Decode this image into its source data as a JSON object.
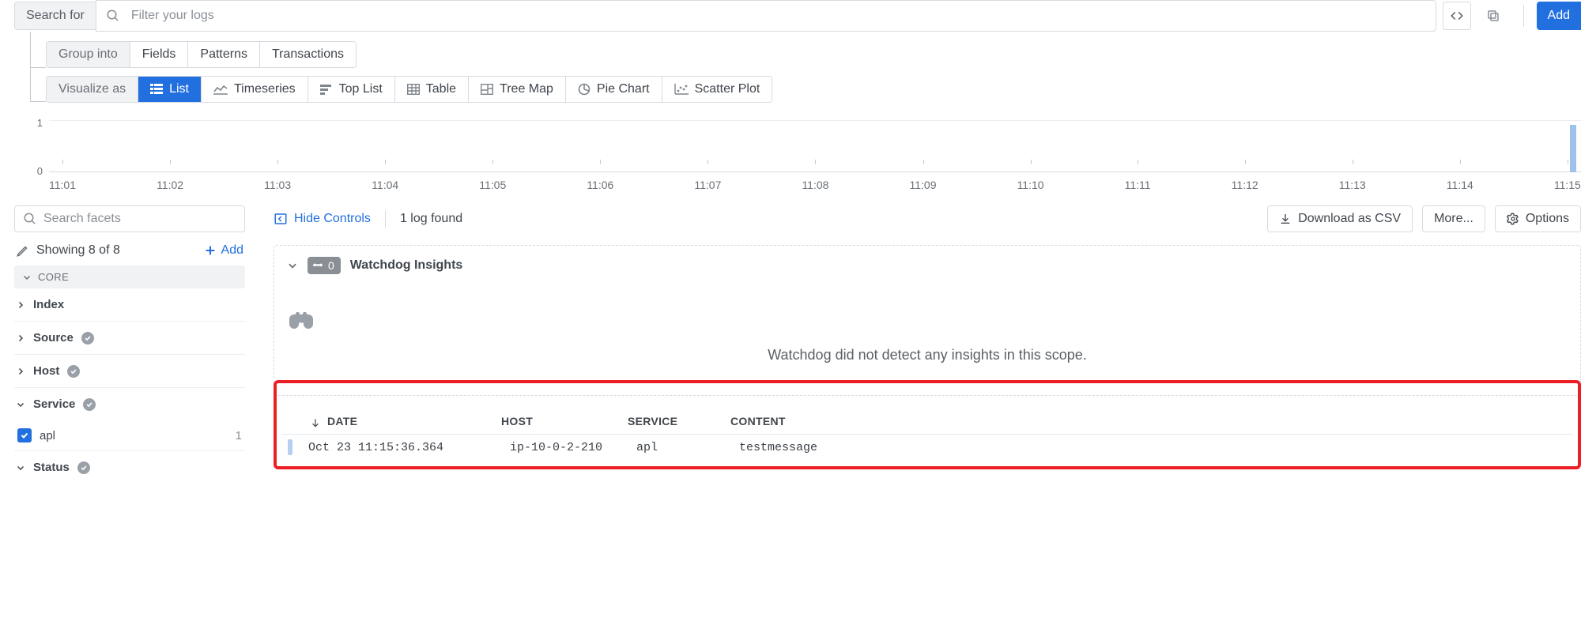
{
  "search": {
    "label": "Search for",
    "placeholder": "Filter your logs"
  },
  "add_label": "Add",
  "group_into": {
    "label": "Group into",
    "options": [
      "Fields",
      "Patterns",
      "Transactions"
    ]
  },
  "visualize": {
    "label": "Visualize as",
    "active": "List",
    "options": [
      "List",
      "Timeseries",
      "Top List",
      "Table",
      "Tree Map",
      "Pie Chart",
      "Scatter Plot"
    ]
  },
  "chart_data": {
    "type": "bar",
    "title": "",
    "xlabel": "",
    "ylabel": "",
    "ylim": [
      0,
      1
    ],
    "yticks": [
      0,
      1
    ],
    "categories": [
      "11:01",
      "11:02",
      "11:03",
      "11:04",
      "11:05",
      "11:06",
      "11:07",
      "11:08",
      "11:09",
      "11:10",
      "11:11",
      "11:12",
      "11:13",
      "11:14",
      "11:15"
    ],
    "values": [
      0,
      0,
      0,
      0,
      0,
      0,
      0,
      0,
      0,
      0,
      0,
      0,
      0,
      0,
      1
    ]
  },
  "facets": {
    "search_placeholder": "Search facets",
    "showing_prefix": "Showing",
    "showing_count": "8 of 8",
    "add_label": "Add",
    "group_label": "CORE",
    "items": [
      {
        "label": "Index",
        "expanded": false,
        "has_dot": false
      },
      {
        "label": "Source",
        "expanded": false,
        "has_dot": true
      },
      {
        "label": "Host",
        "expanded": false,
        "has_dot": true
      },
      {
        "label": "Service",
        "expanded": true,
        "has_dot": true
      },
      {
        "label": "Status",
        "expanded": true,
        "has_dot": true
      }
    ],
    "service_item": {
      "label": "apl",
      "count": 1
    }
  },
  "toolbar": {
    "hide_controls": "Hide Controls",
    "log_count": "1 log found",
    "download_csv": "Download as CSV",
    "more": "More...",
    "options": "Options"
  },
  "insights": {
    "badge_count": 0,
    "title": "Watchdog Insights",
    "empty_text": "Watchdog did not detect any insights in this scope."
  },
  "log_columns": {
    "date": "DATE",
    "host": "HOST",
    "service": "SERVICE",
    "content": "CONTENT"
  },
  "log_row": {
    "date": "Oct 23 11:15:36.364",
    "host": "ip-10-0-2-210",
    "service": "apl",
    "content": "testmessage"
  }
}
